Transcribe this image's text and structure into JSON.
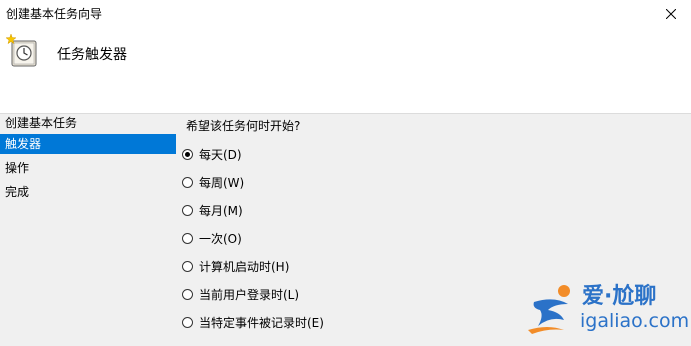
{
  "window": {
    "title": "创建基本任务向导"
  },
  "header": {
    "title": "任务触发器",
    "icon": "clock-task-icon"
  },
  "sidebar": {
    "items": [
      {
        "label": "创建基本任务",
        "selected": false
      },
      {
        "label": "触发器",
        "selected": true
      },
      {
        "label": "操作",
        "selected": false
      },
      {
        "label": "完成",
        "selected": false
      }
    ]
  },
  "main": {
    "question": "希望该任务何时开始?",
    "options": [
      {
        "label": "每天(D)",
        "checked": true
      },
      {
        "label": "每周(W)",
        "checked": false
      },
      {
        "label": "每月(M)",
        "checked": false
      },
      {
        "label": "一次(O)",
        "checked": false
      },
      {
        "label": "计算机启动时(H)",
        "checked": false
      },
      {
        "label": "当前用户登录时(L)",
        "checked": false
      },
      {
        "label": "当特定事件被记录时(E)",
        "checked": false
      }
    ]
  },
  "watermark": {
    "title": "爱·尬聊",
    "url": "igaliao.com"
  },
  "colors": {
    "selection": "#0078d7",
    "watermark": "#2b72c8",
    "accent_orange": "#f28c28"
  }
}
